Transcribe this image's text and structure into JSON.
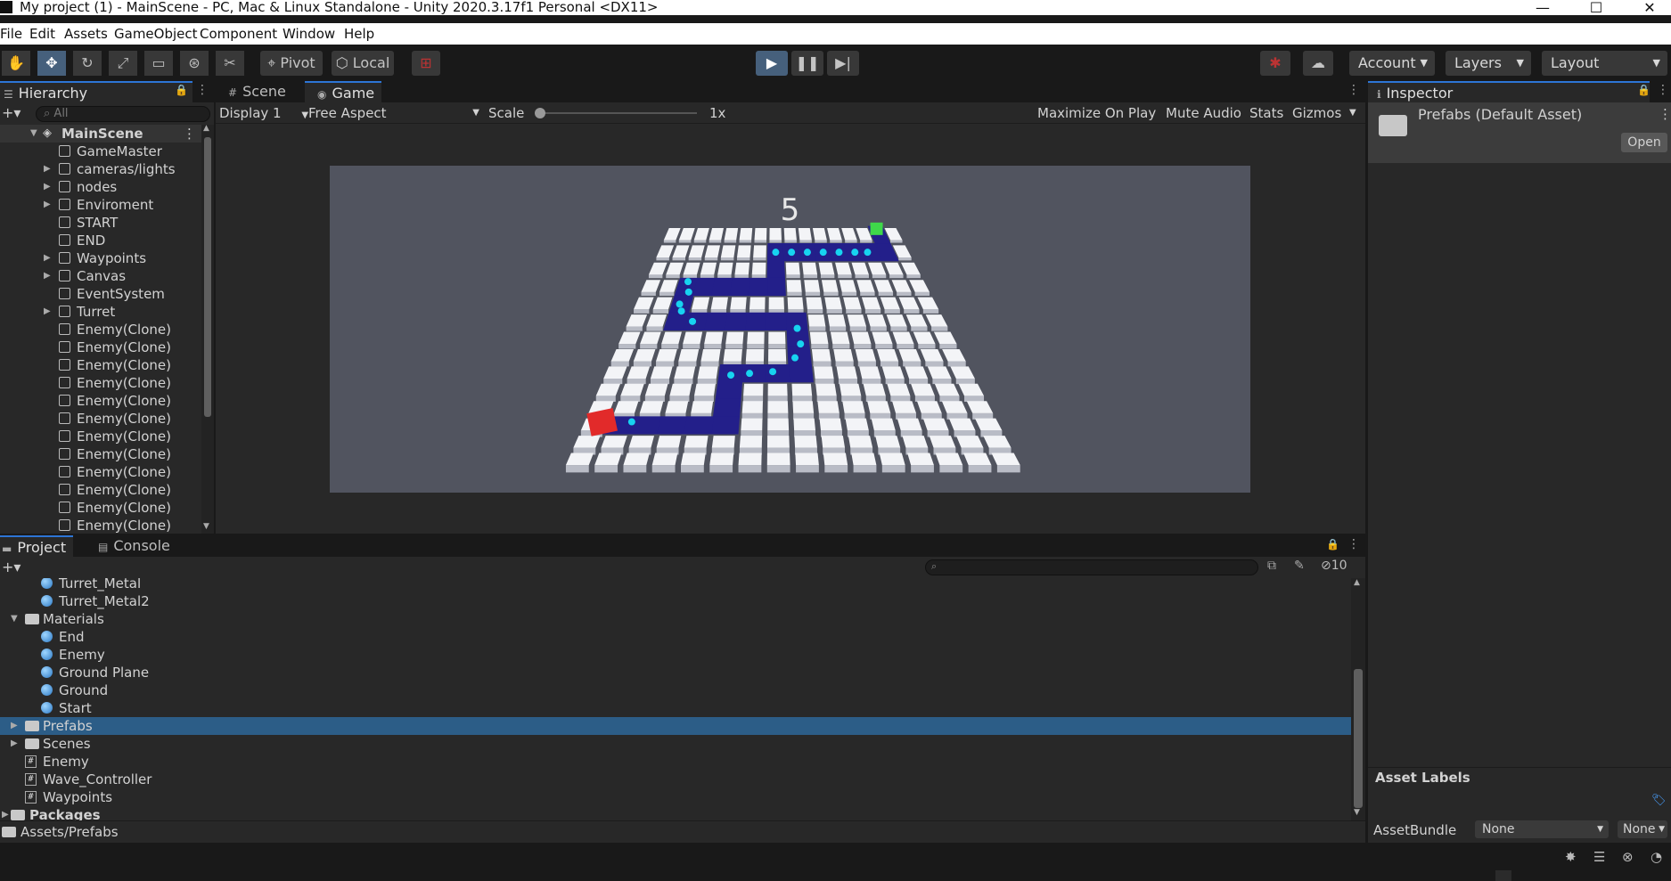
{
  "window": {
    "title": "My project (1) - MainScene - PC, Mac & Linux Standalone - Unity 2020.3.17f1 Personal <DX11>",
    "minimize": "—",
    "maximize": "☐",
    "close": "✕"
  },
  "menu": [
    "File",
    "Edit",
    "Assets",
    "GameObject",
    "Component",
    "Window",
    "Help"
  ],
  "toolbar": {
    "pivot_label": "Pivot",
    "local_label": "Local",
    "account_label": "Account",
    "layers_label": "Layers",
    "layout_label": "Layout"
  },
  "hierarchy": {
    "title": "Hierarchy",
    "search_placeholder": "All",
    "scene_name": "MainScene",
    "items": [
      {
        "label": "GameMaster",
        "expandable": false
      },
      {
        "label": "cameras/lights",
        "expandable": true
      },
      {
        "label": "nodes",
        "expandable": true
      },
      {
        "label": "Enviroment",
        "expandable": true
      },
      {
        "label": "START",
        "expandable": false
      },
      {
        "label": "END",
        "expandable": false
      },
      {
        "label": "Waypoints",
        "expandable": true
      },
      {
        "label": "Canvas",
        "expandable": true
      },
      {
        "label": "EventSystem",
        "expandable": false
      },
      {
        "label": "Turret",
        "expandable": true
      },
      {
        "label": "Enemy(Clone)",
        "expandable": false
      },
      {
        "label": "Enemy(Clone)",
        "expandable": false
      },
      {
        "label": "Enemy(Clone)",
        "expandable": false
      },
      {
        "label": "Enemy(Clone)",
        "expandable": false
      },
      {
        "label": "Enemy(Clone)",
        "expandable": false
      },
      {
        "label": "Enemy(Clone)",
        "expandable": false
      },
      {
        "label": "Enemy(Clone)",
        "expandable": false
      },
      {
        "label": "Enemy(Clone)",
        "expandable": false
      },
      {
        "label": "Enemy(Clone)",
        "expandable": false
      },
      {
        "label": "Enemy(Clone)",
        "expandable": false
      },
      {
        "label": "Enemy(Clone)",
        "expandable": false
      },
      {
        "label": "Enemy(Clone)",
        "expandable": false
      }
    ]
  },
  "center_tabs": {
    "scene": "Scene",
    "game": "Game"
  },
  "gamebar": {
    "display": "Display 1",
    "aspect": "Free Aspect",
    "scale_label": "Scale",
    "scale_value": "1x",
    "maximize": "Maximize On Play",
    "mute": "Mute Audio",
    "stats": "Stats",
    "gizmos": "Gizmos"
  },
  "game": {
    "wave_countdown": "5"
  },
  "inspector": {
    "title": "Inspector",
    "asset_name": "Prefabs (Default Asset)",
    "open_button": "Open",
    "asset_labels": "Asset Labels",
    "assetbundle_label": "AssetBundle",
    "bundle_value": "None",
    "variant_value": "None"
  },
  "project": {
    "tab_project": "Project",
    "tab_console": "Console",
    "hidden_count": "10",
    "items": [
      {
        "label": "Turret_Metal",
        "type": "material",
        "depth": 2
      },
      {
        "label": "Turret_Metal2",
        "type": "material",
        "depth": 2
      },
      {
        "label": "Materials",
        "type": "folder-open",
        "depth": 1
      },
      {
        "label": "End",
        "type": "material",
        "depth": 2
      },
      {
        "label": "Enemy",
        "type": "material",
        "depth": 2
      },
      {
        "label": "Ground Plane",
        "type": "material",
        "depth": 2
      },
      {
        "label": "Ground",
        "type": "material",
        "depth": 2
      },
      {
        "label": "Start",
        "type": "material",
        "depth": 2
      },
      {
        "label": "Prefabs",
        "type": "folder",
        "depth": 1,
        "selected": true
      },
      {
        "label": "Scenes",
        "type": "folder",
        "depth": 1
      },
      {
        "label": "Enemy",
        "type": "script",
        "depth": 1
      },
      {
        "label": "Wave_Controller",
        "type": "script",
        "depth": 1
      },
      {
        "label": "Waypoints",
        "type": "script",
        "depth": 1
      }
    ],
    "packages": "Packages",
    "path": "Assets/Prefabs"
  },
  "colors": {
    "accent": "#2d75d6",
    "selection": "#2c5d87",
    "path": "#231f8a",
    "start": "#e22a2a",
    "end": "#3fd84a",
    "enemy": "#17d3f0"
  }
}
